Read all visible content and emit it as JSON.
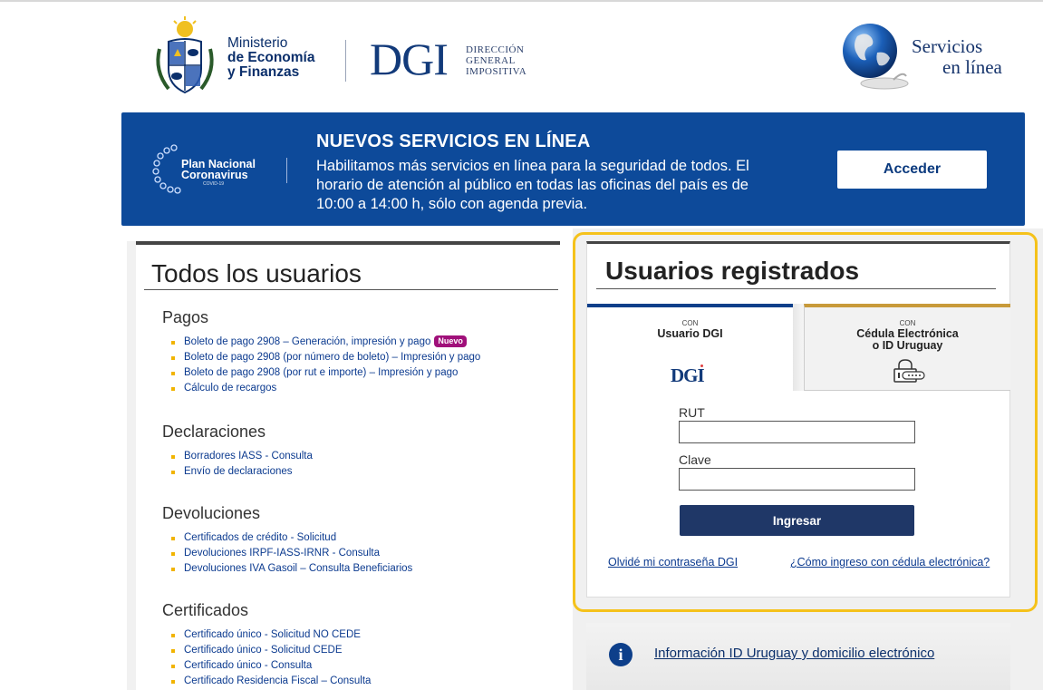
{
  "header": {
    "ministry": {
      "line1": "Ministerio",
      "line2": "de Economía",
      "line3": "y Finanzas"
    },
    "dgi": {
      "acronym": "DGI",
      "line1": "DIRECCIÓN",
      "line2": "GENERAL",
      "line3": "IMPOSITIVA"
    },
    "servicios": {
      "line1": "Servicios",
      "line2": "en línea"
    }
  },
  "banner": {
    "plan_line1": "Plan Nacional",
    "plan_line2": "Coronavirus",
    "plan_small": "COVID-19",
    "title": "NUEVOS SERVICIOS EN LÍNEA",
    "body": "Habilitamos más servicios en línea para la seguridad de todos. El horario de atención al público en todas las oficinas del país es de 10:00 a 14:00 h, sólo con agenda previa.",
    "button": "Acceder",
    "color": "#0d4a9a"
  },
  "todos": {
    "title": "Todos los usuarios",
    "sections": [
      {
        "heading": "Pagos",
        "items": [
          "Boleto de pago 2908 – Generación, impresión y pago",
          "Boleto de pago 2908 (por número de boleto) – Impresión y pago",
          "Boleto de pago 2908 (por rut e importe) – Impresión y pago",
          "Cálculo de recargos"
        ],
        "badge": "Nuevo"
      },
      {
        "heading": "Declaraciones",
        "items": [
          "Borradores IASS - Consulta",
          "Envío de declaraciones"
        ]
      },
      {
        "heading": "Devoluciones",
        "items": [
          "Certificados de crédito - Solicitud",
          "Devoluciones IRPF-IASS-IRNR - Consulta",
          "Devoluciones IVA Gasoil – Consulta Beneficiarios"
        ]
      },
      {
        "heading": "Certificados",
        "items": [
          "Certificado único - Solicitud NO CEDE",
          "Certificado único - Solicitud CEDE",
          "Certificado único - Consulta",
          "Certificado Residencia Fiscal – Consulta"
        ]
      }
    ]
  },
  "registrados": {
    "title": "Usuarios registrados",
    "tab_dgi": {
      "con": "CON",
      "label": "Usuario DGI",
      "logo": "DGI"
    },
    "tab_cedula": {
      "con": "CON",
      "label_line1": "Cédula Electrónica",
      "label_line2": "o ID Uruguay"
    },
    "rut_label": "RUT",
    "rut_value": "",
    "clave_label": "Clave",
    "clave_value": "",
    "submit": "Ingresar",
    "forgot_link": "Olvidé mi contraseña DGI",
    "cedula_link": "¿Cómo ingreso con cédula electrónica?",
    "highlight_color": "#f5c21b"
  },
  "info": {
    "icon": "info-icon",
    "link": "Información ID Uruguay y domicilio electrónico"
  }
}
